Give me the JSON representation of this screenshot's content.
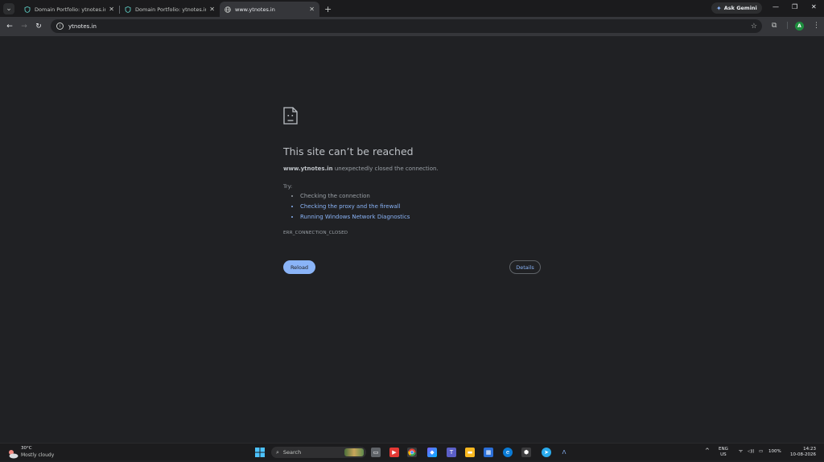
{
  "browser": {
    "tabs": [
      {
        "title": "Domain Portfolio: ytnotes.in",
        "favicon": "shield-icon",
        "active": false
      },
      {
        "title": "Domain Portfolio: ytnotes.in",
        "favicon": "shield-icon",
        "active": false
      },
      {
        "title": "www.ytnotes.in",
        "favicon": "globe-icon",
        "active": true
      }
    ],
    "ask_gemini": "Ask Gemini",
    "url": "ytnotes.in",
    "profile_initial": "A"
  },
  "error_page": {
    "title": "This site can’t be reached",
    "host": "www.ytnotes.in",
    "description": "unexpectedly closed the connection.",
    "try_label": "Try:",
    "suggestions": [
      {
        "text": "Checking the connection",
        "link": false
      },
      {
        "text": "Checking the proxy and the firewall",
        "link": true
      },
      {
        "text": "Running Windows Network Diagnostics",
        "link": true
      }
    ],
    "error_code": "ERR_CONNECTION_CLOSED",
    "reload_label": "Reload",
    "details_label": "Details"
  },
  "taskbar": {
    "weather_temp": "30°C",
    "weather_desc": "Mostly cloudy",
    "search_placeholder": "Search",
    "language_top": "ENG",
    "language_bottom": "US",
    "battery": "100%",
    "time": "14:23",
    "date": "10-08-2026"
  },
  "colors": {
    "page_bg": "#202124",
    "accent": "#8ab4f8",
    "toolbar_bg": "#35363a"
  }
}
